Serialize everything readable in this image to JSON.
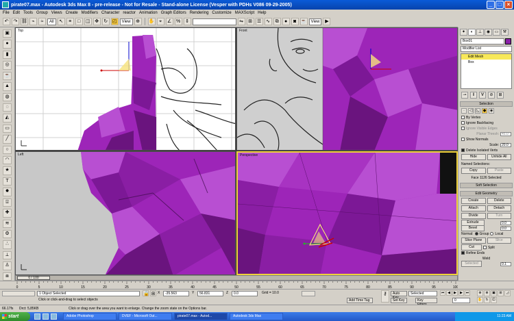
{
  "window": {
    "title": "pirate07.max - Autodesk 3ds Max 8 - pre-release - Not for Resale - Stand-alone License (Vesper with PDHs V086 09-29-2005)",
    "controls": [
      "_",
      "□",
      "×"
    ]
  },
  "menubar": [
    "File",
    "Edit",
    "Tools",
    "Group",
    "Views",
    "Create",
    "Modifiers",
    "Character",
    "reactor",
    "Animation",
    "Graph Editors",
    "Rendering",
    "Customize",
    "MAXScript",
    "Help"
  ],
  "toolbar": {
    "selection_filter": "All",
    "ref_coord": "View",
    "ref_coord_2": "View"
  },
  "viewports": {
    "top_label": "Top",
    "front_label": "Front",
    "left_label": "Left",
    "perspective_label": "Perspective",
    "colors": {
      "mesh": "#9d25b8",
      "mesh_dark": "#6a147e",
      "mesh_light": "#b84fd2",
      "active_border": "#f0d23a"
    }
  },
  "command_panel": {
    "object_name": "Box01",
    "modifier_list": "Modifier List",
    "stack": [
      "Edit Mesh",
      "Box"
    ],
    "selection": {
      "title": "Selection",
      "by_vertex": "By Vertex",
      "ignore_backfacing": "Ignore Backfacing",
      "ignore_visible_edges": "Ignore Visible Edges",
      "planar_thresh_label": "Planar Thresh:",
      "planar_thresh": "45.0",
      "show_normals": "Show Normals",
      "scale_label": "Scale:",
      "scale": "20.0",
      "delete_isolated": "Delete Isolated Verts",
      "hide": "Hide",
      "unhide_all": "Unhide All",
      "named_selections": "Named Selections:",
      "copy": "Copy",
      "paste": "Paste",
      "status": "Face 1126 Selected"
    },
    "soft_selection": "Soft Selection",
    "edit_geometry": {
      "title": "Edit Geometry",
      "create": "Create",
      "delete": "Delete",
      "attach": "Attach",
      "detach": "Detach",
      "divide": "Divide",
      "turn": "Turn",
      "extrude_label": "Extrude",
      "extrude": "0.0",
      "bevel_label": "Bevel",
      "bevel": "0.0",
      "normal_label": "Normal:",
      "group": "Group",
      "local": "Local",
      "slice_plane": "Slice Plane",
      "slice": "Slice",
      "cut": "Cut",
      "split": "Split",
      "refine_ends": "Refine Ends",
      "weld": "Weld",
      "selected": "Selected",
      "selected_val": "0.1"
    }
  },
  "timeline": {
    "slider": "0 / 100",
    "ticks": [
      "0",
      "5",
      "10",
      "15",
      "20",
      "25",
      "30",
      "35",
      "40",
      "45",
      "50",
      "55",
      "60",
      "65",
      "70",
      "75",
      "80",
      "85",
      "90",
      "95",
      "100"
    ]
  },
  "status": {
    "selected": "1 Object Selected",
    "prompt_top": "Click or drag over the area you want to enlarge. Change the zoom state on the Options bar.",
    "prompt": "Click or click-and-drag to select objects",
    "x_label": "X",
    "x": "-35.563",
    "y_label": "Y",
    "y": "56.831",
    "z_label": "Z",
    "z": "0.0",
    "grid": "Grid = 10.0",
    "add_time_tag": "Add Time Tag",
    "auto_key": "Auto Key",
    "set_key": "Set Key",
    "key_mode": "Selected",
    "key_filters": "Key Filters...",
    "frame": "0",
    "fps_left": "66.17fs",
    "disk": "Drct: 5,85KB",
    "maxscript_label": "Max"
  },
  "taskbar": {
    "start": "start",
    "tasks": [
      "Adobe Photoshop",
      "DVEF - Microsoft Out...",
      "pirate07.max - Autod...",
      "Autodesk 3ds Max"
    ],
    "clock": "11:23 AM"
  }
}
